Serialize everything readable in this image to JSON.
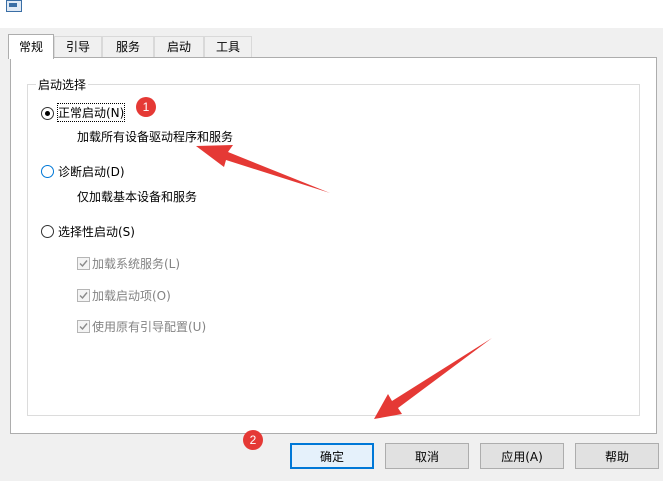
{
  "tabs": [
    {
      "label": "常规"
    },
    {
      "label": "引导"
    },
    {
      "label": "服务"
    },
    {
      "label": "启动"
    },
    {
      "label": "工具"
    }
  ],
  "startup_group": {
    "legend": "启动选择",
    "normal": {
      "label": "正常启动(N)",
      "desc": "加载所有设备驱动程序和服务",
      "selected": true
    },
    "diagnostic": {
      "label": "诊断启动(D)",
      "desc": "仅加载基本设备和服务",
      "selected": false
    },
    "selective": {
      "label": "选择性启动(S)",
      "selected": false,
      "options": [
        {
          "label": "加载系统服务(L)",
          "checked": true
        },
        {
          "label": "加载启动项(O)",
          "checked": true
        },
        {
          "label": "使用原有引导配置(U)",
          "checked": true
        }
      ]
    }
  },
  "buttons": {
    "ok": "确定",
    "cancel": "取消",
    "apply": "应用(A)",
    "help": "帮助"
  },
  "annotations": {
    "badge1": "1",
    "badge2": "2",
    "color": "#e53935"
  }
}
